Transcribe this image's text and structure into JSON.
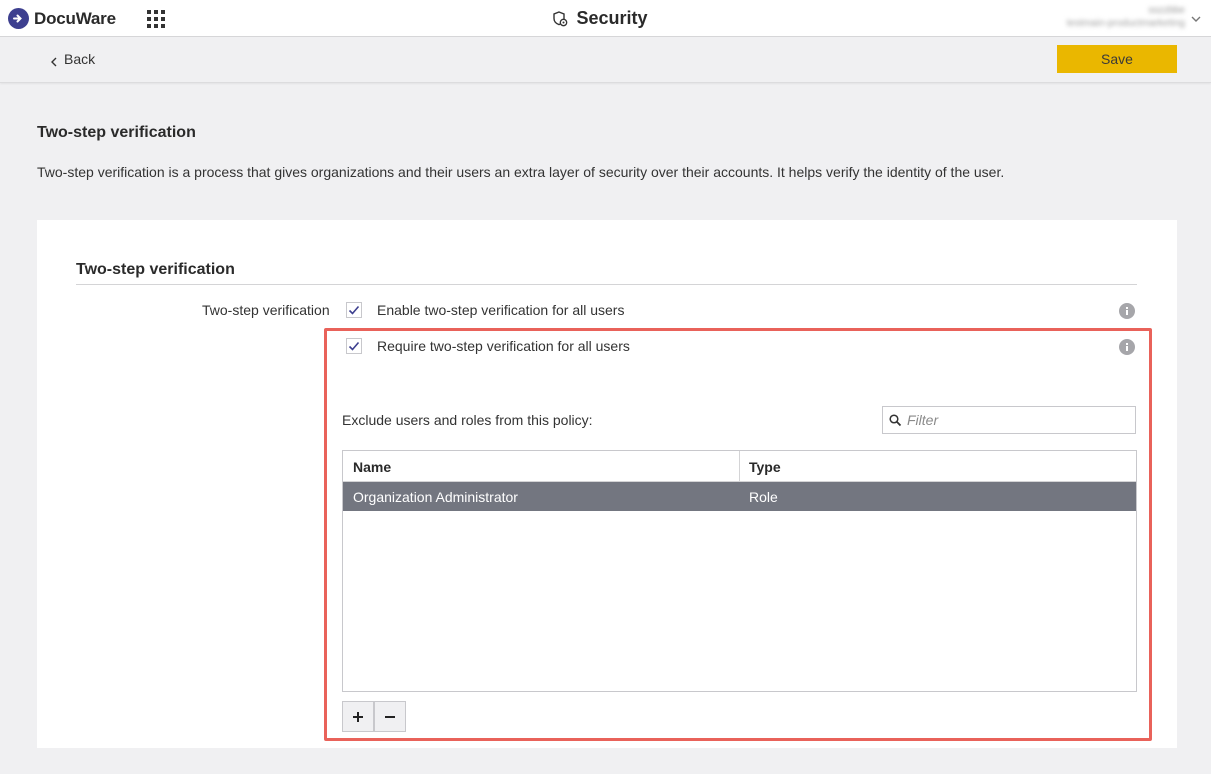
{
  "app": {
    "brand": "DocuWare",
    "page_title": "Security",
    "user_name": "sszzbbe",
    "user_org": "testmain-productmarketing"
  },
  "subbar": {
    "back_label": "Back",
    "save_label": "Save"
  },
  "intro": {
    "heading": "Two-step verification",
    "description": "Two-step verification is a process that gives organizations and their users an extra layer of security over their accounts. It helps verify the identity of the user."
  },
  "settings": {
    "heading": "Two-step verification",
    "row_label": "Two-step verification",
    "enable_label": "Enable two-step verification for all users",
    "enable_checked": true,
    "require_label": "Require two-step verification for all users",
    "require_checked": true,
    "exclude_label": "Exclude users and roles from this policy:",
    "filter_placeholder": "Filter"
  },
  "table": {
    "columns": [
      "Name",
      "Type"
    ],
    "rows": [
      {
        "name": "Organization Administrator",
        "type": "Role",
        "selected": true
      }
    ]
  },
  "toolbar": {
    "add_label": "+",
    "remove_label": "−"
  },
  "colors": {
    "accent": "#eab700",
    "brand": "#3d3f8f",
    "highlight": "#e9625a",
    "selected_row": "#737680"
  },
  "icons": [
    "docuware-logo-icon",
    "apps-grid-icon",
    "shield-gear-icon",
    "chevron-down-icon",
    "chevron-left-icon",
    "check-icon",
    "info-icon",
    "search-icon"
  ]
}
